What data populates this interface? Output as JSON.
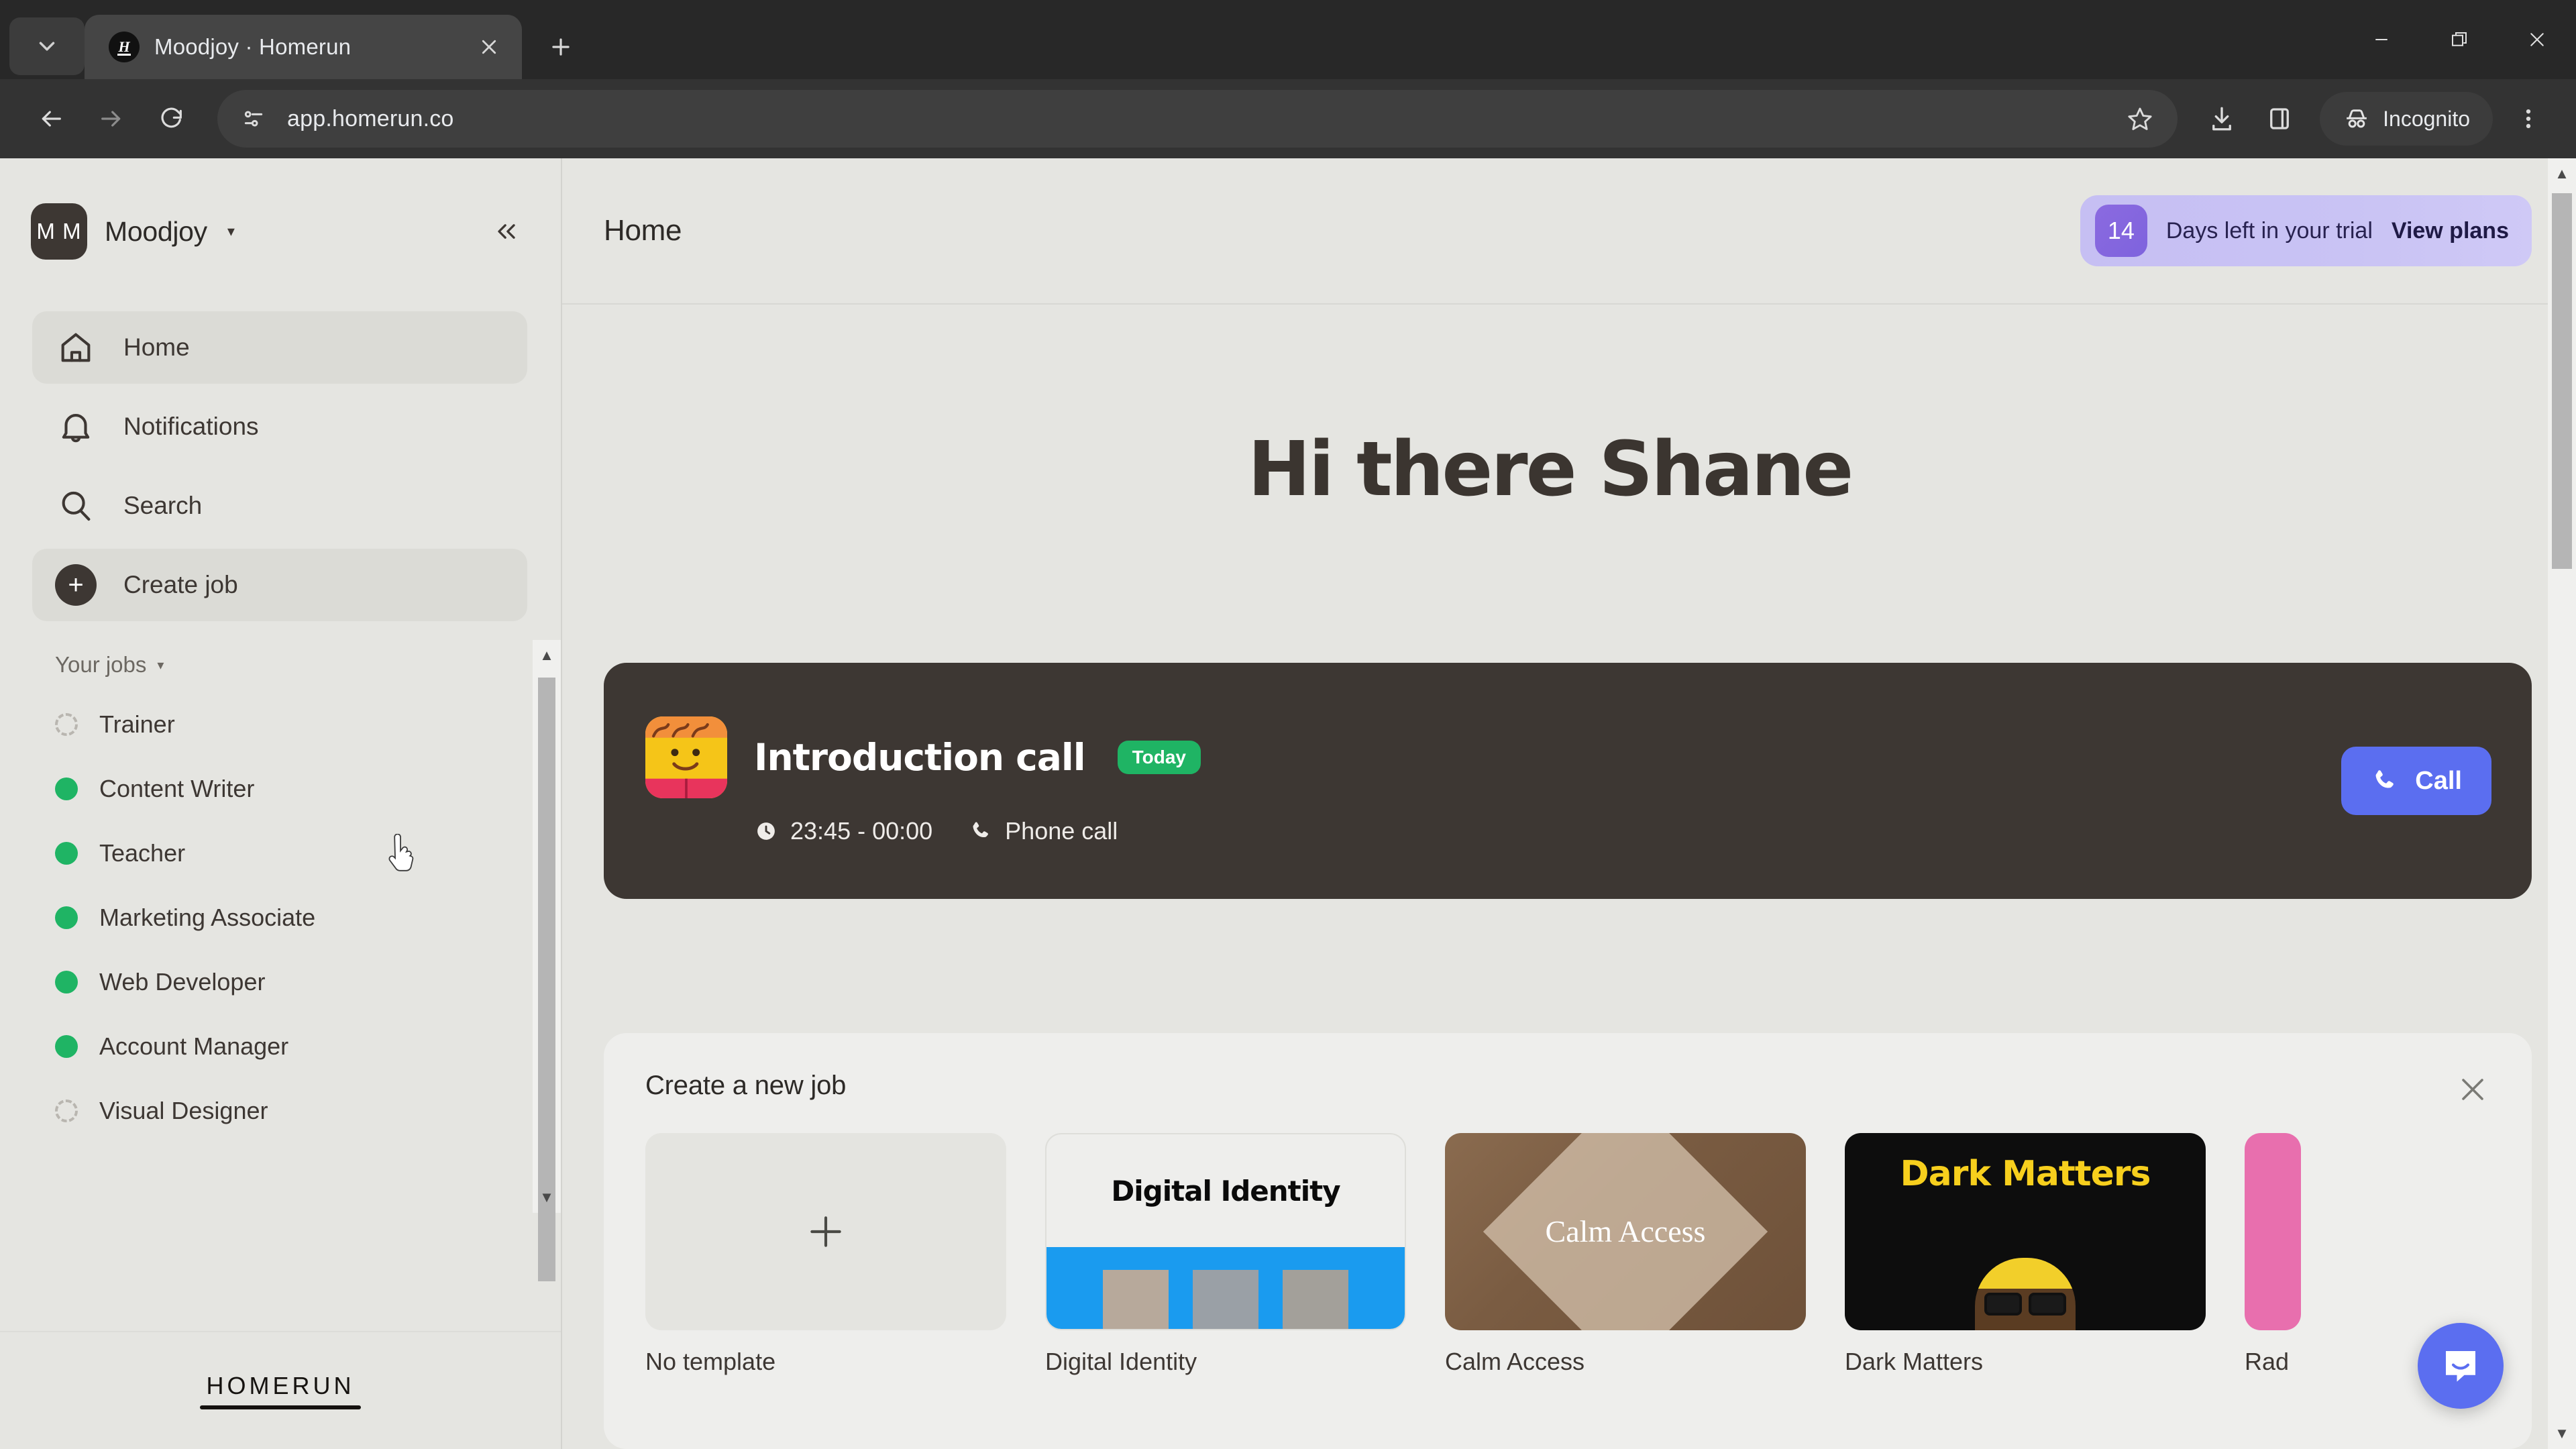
{
  "browser": {
    "tab": {
      "title": "Moodjoy · Homerun",
      "favicon_letter": "H"
    },
    "tab_search_icon": "chevron-down-icon",
    "new_tab_icon": "plus-icon",
    "window_controls": {
      "minimize": "minimize-icon",
      "maximize": "restore-icon",
      "close": "close-icon"
    },
    "toolbar": {
      "back_icon": "arrow-left-icon",
      "forward_icon": "arrow-right-icon",
      "reload_icon": "reload-icon",
      "site_info_icon": "page-settings-icon",
      "url": "app.homerun.co",
      "bookmark_icon": "star-icon",
      "downloads_icon": "download-icon",
      "side_panel_icon": "side-panel-icon",
      "incognito_label": "Incognito",
      "incognito_icon": "incognito-icon",
      "menu_icon": "three-dots-icon"
    }
  },
  "sidebar": {
    "org": {
      "avatar_initials": "M M",
      "name": "Moodjoy",
      "caret_icon": "chevron-down-icon"
    },
    "collapse_icon": "chevrons-left-icon",
    "nav": [
      {
        "label": "Home",
        "icon": "home-icon",
        "active": true
      },
      {
        "label": "Notifications",
        "icon": "bell-icon",
        "active": false
      },
      {
        "label": "Search",
        "icon": "search-icon",
        "active": false
      },
      {
        "label": "Create job",
        "icon": "plus-circle-icon",
        "active": false,
        "hovered": true
      }
    ],
    "jobs_section": {
      "label": "Your jobs",
      "caret_icon": "caret-down-icon"
    },
    "jobs": [
      {
        "label": "Trainer",
        "status": "draft"
      },
      {
        "label": "Content Writer",
        "status": "live"
      },
      {
        "label": "Teacher",
        "status": "live"
      },
      {
        "label": "Marketing Associate",
        "status": "live"
      },
      {
        "label": "Web Developer",
        "status": "live"
      },
      {
        "label": "Account Manager",
        "status": "live"
      },
      {
        "label": "Visual Designer",
        "status": "draft"
      }
    ],
    "footer_logo": "HOMERUN"
  },
  "main": {
    "page_title": "Home",
    "trial": {
      "days": "14",
      "text": "Days left in your trial",
      "cta": "View plans"
    },
    "greeting": "Hi there Shane",
    "event_card": {
      "avatar_icon": "person-emoji-avatar",
      "title": "Introduction call",
      "badge": "Today",
      "time_icon": "clock-icon",
      "time": "23:45 - 00:00",
      "type_icon": "phone-icon",
      "type": "Phone call",
      "action_icon": "phone-icon",
      "action_label": "Call"
    },
    "new_job_panel": {
      "title": "Create a new job",
      "close_icon": "close-icon",
      "templates": [
        {
          "label": "No template",
          "kind": "empty",
          "icon": "plus-icon"
        },
        {
          "label": "Digital Identity",
          "kind": "digital-identity",
          "thumb_text": "Digital Identity"
        },
        {
          "label": "Calm Access",
          "kind": "calm-access",
          "thumb_text": "Calm Access"
        },
        {
          "label": "Dark Matters",
          "kind": "dark-matters",
          "thumb_text": "Dark Matters"
        },
        {
          "label": "Rad",
          "kind": "pink-clipped",
          "thumb_text": ""
        }
      ]
    },
    "chat_bubble_icon": "intercom-chat-icon"
  },
  "colors": {
    "app_bg": "#e5e5e1",
    "dark_card": "#3d3733",
    "accent_blue": "#5b6ef0",
    "status_green": "#1fb464",
    "trial_purple": "#c6bff3"
  }
}
